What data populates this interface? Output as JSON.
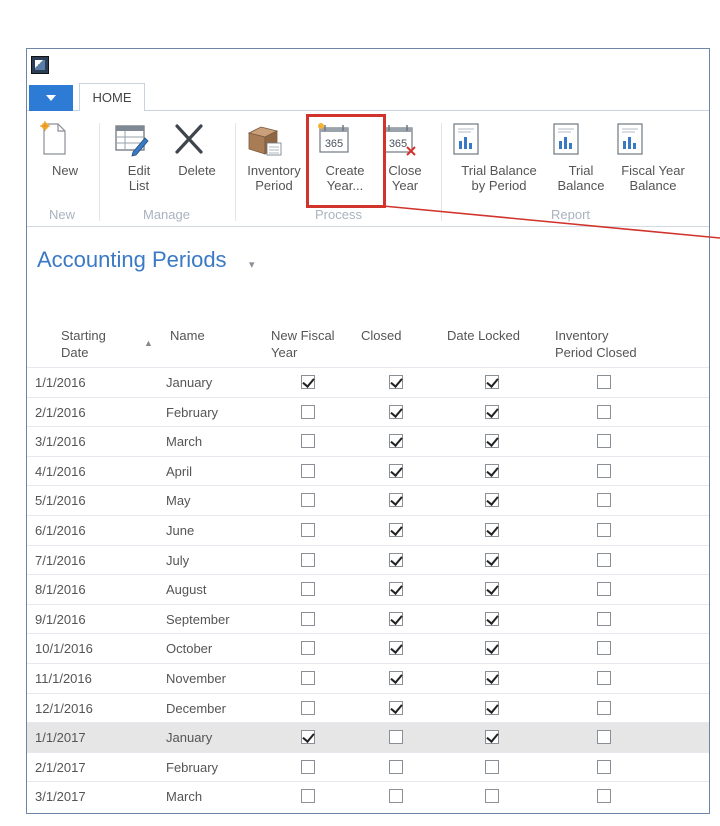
{
  "ribbon": {
    "tab_home": "HOME",
    "buttons": {
      "new": "New",
      "edit_list_1": "Edit",
      "edit_list_2": "List",
      "delete": "Delete",
      "inventory_period_1": "Inventory",
      "inventory_period_2": "Period",
      "create_year_1": "Create",
      "create_year_2": "Year...",
      "close_year_1": "Close",
      "close_year_2": "Year",
      "trial_balance_by_period_1": "Trial Balance",
      "trial_balance_by_period_2": "by Period",
      "trial_balance_1": "Trial",
      "trial_balance_2": "Balance",
      "fiscal_year_balance_1": "Fiscal Year",
      "fiscal_year_balance_2": "Balance"
    },
    "calendar_number": "365",
    "groups": {
      "new": "New",
      "manage": "Manage",
      "process": "Process",
      "report": "Report"
    }
  },
  "page": {
    "title": "Accounting Periods",
    "title_caret": "▾"
  },
  "columns": {
    "starting_date_1": "Starting",
    "starting_date_2": "Date",
    "name": "Name",
    "new_fiscal_year_1": "New Fiscal",
    "new_fiscal_year_2": "Year",
    "closed": "Closed",
    "date_locked": "Date Locked",
    "inventory_period_closed_1": "Inventory",
    "inventory_period_closed_2": "Period Closed"
  },
  "rows": [
    {
      "date": "1/1/2016",
      "name": "January",
      "new_fiscal_year": true,
      "closed": true,
      "date_locked": true,
      "inventory_closed": false
    },
    {
      "date": "2/1/2016",
      "name": "February",
      "new_fiscal_year": false,
      "closed": true,
      "date_locked": true,
      "inventory_closed": false
    },
    {
      "date": "3/1/2016",
      "name": "March",
      "new_fiscal_year": false,
      "closed": true,
      "date_locked": true,
      "inventory_closed": false
    },
    {
      "date": "4/1/2016",
      "name": "April",
      "new_fiscal_year": false,
      "closed": true,
      "date_locked": true,
      "inventory_closed": false
    },
    {
      "date": "5/1/2016",
      "name": "May",
      "new_fiscal_year": false,
      "closed": true,
      "date_locked": true,
      "inventory_closed": false
    },
    {
      "date": "6/1/2016",
      "name": "June",
      "new_fiscal_year": false,
      "closed": true,
      "date_locked": true,
      "inventory_closed": false
    },
    {
      "date": "7/1/2016",
      "name": "July",
      "new_fiscal_year": false,
      "closed": true,
      "date_locked": true,
      "inventory_closed": false
    },
    {
      "date": "8/1/2016",
      "name": "August",
      "new_fiscal_year": false,
      "closed": true,
      "date_locked": true,
      "inventory_closed": false
    },
    {
      "date": "9/1/2016",
      "name": "September",
      "new_fiscal_year": false,
      "closed": true,
      "date_locked": true,
      "inventory_closed": false
    },
    {
      "date": "10/1/2016",
      "name": "October",
      "new_fiscal_year": false,
      "closed": true,
      "date_locked": true,
      "inventory_closed": false
    },
    {
      "date": "11/1/2016",
      "name": "November",
      "new_fiscal_year": false,
      "closed": true,
      "date_locked": true,
      "inventory_closed": false
    },
    {
      "date": "12/1/2016",
      "name": "December",
      "new_fiscal_year": false,
      "closed": true,
      "date_locked": true,
      "inventory_closed": false
    },
    {
      "date": "1/1/2017",
      "name": "January",
      "new_fiscal_year": true,
      "closed": false,
      "date_locked": true,
      "inventory_closed": false,
      "selected": true
    },
    {
      "date": "2/1/2017",
      "name": "February",
      "new_fiscal_year": false,
      "closed": false,
      "date_locked": false,
      "inventory_closed": false
    },
    {
      "date": "3/1/2017",
      "name": "March",
      "new_fiscal_year": false,
      "closed": false,
      "date_locked": false,
      "inventory_closed": false
    }
  ],
  "colors": {
    "accent": "#3a79c4",
    "file_tab": "#2e7bd6",
    "highlight": "#d0342c"
  },
  "icons": {
    "new": "document-new-icon",
    "edit_list": "edit-list-icon",
    "delete": "delete-x-icon",
    "inventory_period": "inventory-box-icon",
    "create_year": "calendar-365-icon",
    "close_year": "calendar-365-close-icon",
    "report": "report-chart-icon"
  }
}
